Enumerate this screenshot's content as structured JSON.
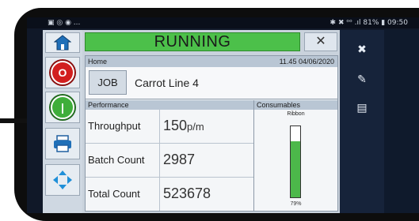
{
  "status_bar": {
    "left_icons": "▣ ◎ ◉ ...",
    "right_text": "✱ ✖ ᵒᵒ .ıl 81% ▮ 09:50"
  },
  "header": {
    "status": "RUNNING",
    "status_color": "#4cc04a"
  },
  "breadcrumb": {
    "page": "Home",
    "datetime": "11.45 04/06/2020"
  },
  "job": {
    "button_label": "JOB",
    "name": "Carrot Line 4"
  },
  "performance": {
    "title": "Performance",
    "rows": [
      {
        "label": "Throughput",
        "value": "150",
        "unit": "p/m"
      },
      {
        "label": "Batch Count",
        "value": "2987",
        "unit": ""
      },
      {
        "label": "Total Count",
        "value": "523678",
        "unit": ""
      }
    ]
  },
  "consumables": {
    "title": "Consumables",
    "ribbon_label": "Ribbon",
    "ribbon_percent_text": "79%",
    "ribbon_level": 0.79
  },
  "left_buttons": {
    "home_icon": "home-icon",
    "stop_icon": "stop-icon",
    "start_icon": "start-icon",
    "print_icon": "printer-icon",
    "move_icon": "move-arrows-icon"
  },
  "right_buttons": {
    "icon1": "disconnect-icon",
    "icon2": "edit-icon",
    "icon3": "keyboard-icon"
  }
}
